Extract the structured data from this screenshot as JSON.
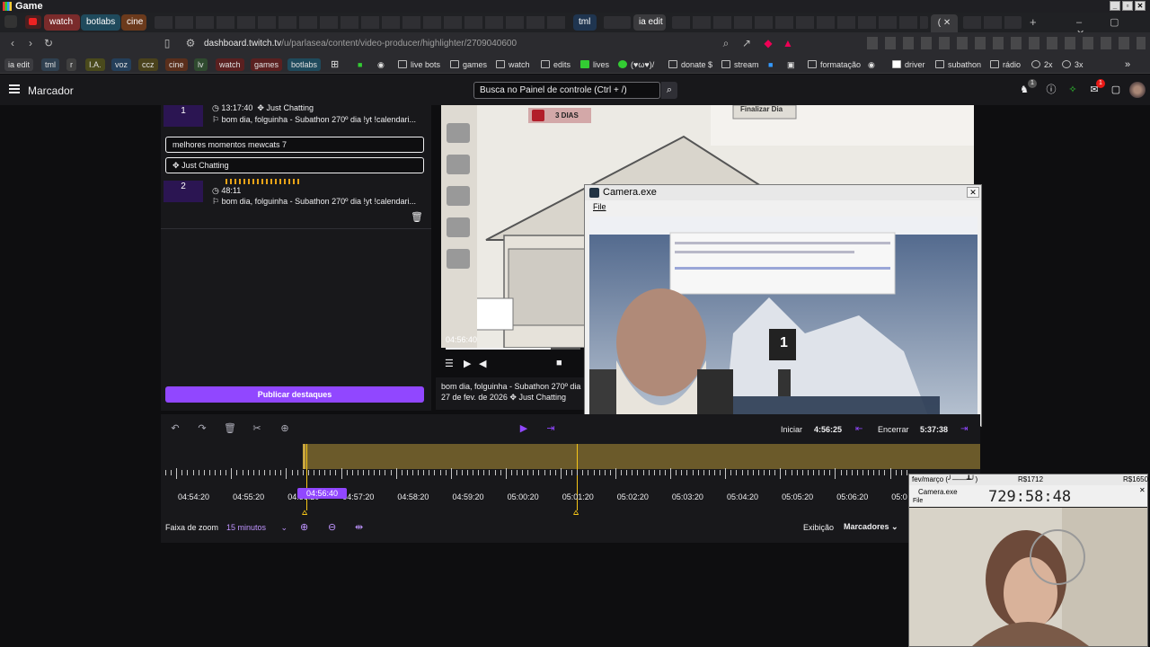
{
  "window": {
    "title": "Game"
  },
  "tabs": [
    {
      "label": "watch",
      "color": "#7a2b2b"
    },
    {
      "label": "botlabs",
      "color": "#1f4a5c"
    },
    {
      "label": "cine",
      "color": "#6b3a1c"
    },
    {
      "label": "tml",
      "color": "#1f3550"
    },
    {
      "label": "ia edit",
      "color": "#3a3a3d"
    }
  ],
  "address": {
    "host": "dashboard.twitch.tv",
    "path": "/u/parlasea/content/video-producer/highlighter/2709040600"
  },
  "bookmarks": {
    "chips": [
      {
        "label": "ia edit",
        "color": "#3c3c40"
      },
      {
        "label": "tml",
        "color": "#2f4050"
      },
      {
        "label": "r",
        "color": "#3f3f3f"
      },
      {
        "label": "I.A.",
        "color": "#4a4a1c"
      },
      {
        "label": "voz",
        "color": "#243f5a"
      },
      {
        "label": "ccz",
        "color": "#4a421c"
      },
      {
        "label": "cine",
        "color": "#5a2f1c"
      },
      {
        "label": "lv",
        "color": "#2f4a2f"
      },
      {
        "label": "watch",
        "color": "#5a2020"
      },
      {
        "label": "games",
        "color": "#5a2020"
      },
      {
        "label": "botlabs",
        "color": "#1f4a5c"
      }
    ],
    "links": [
      "live bots",
      "games",
      "watch",
      "edits",
      "lives",
      "(♥ω♥)/",
      "donate $",
      "stream",
      "formatação",
      "driver",
      "subathon",
      "rádio",
      "2x",
      "3x"
    ]
  },
  "topnav": {
    "page_title": "Marcador",
    "search_placeholder": "Busca no Painel de controle (Ctrl + /)",
    "notif_count": "1"
  },
  "clips": [
    {
      "number": "1",
      "time": "13:17:40",
      "category": "Just Chatting",
      "title": "bom dia, folguinha - Subathon 270º dia !yt !calendari..."
    },
    {
      "number": "2",
      "time": "48:11",
      "category": "",
      "title": "bom dia, folguinha - Subathon 270º dia !yt !calendari..."
    }
  ],
  "editor": {
    "title_value": "melhores momentos mewcats 7",
    "category_value": "Just Chatting",
    "publish_label": "Publicar destaques"
  },
  "game": {
    "days_badge": "3 DIAS",
    "finish_button": "Finalizar Dia"
  },
  "player": {
    "timestamp": "04:56:40"
  },
  "video_info": {
    "title": "bom dia, folguinha - Subathon 270º dia",
    "date": "27 de fev. de 2026",
    "category": "Just Chatting"
  },
  "camera_window": {
    "title": "Camera.exe",
    "menu_file": "File",
    "overlay_number": "1"
  },
  "timeline": {
    "start_label": "Iniciar",
    "start_value": "4:56:25",
    "end_label": "Encerrar",
    "end_value": "5:37:38",
    "playhead_label": "04:56:40",
    "ticks": [
      "04:54:20",
      "04:55:20",
      "04:56:20",
      "04:57:20",
      "04:58:20",
      "04:59:20",
      "05:00:20",
      "05:01:20",
      "05:02:20",
      "05:03:20",
      "05:04:20",
      "05:05:20",
      "05:06:20",
      "05:0"
    ],
    "zoom_label": "Faixa de zoom",
    "zoom_value": "15 minutos",
    "view_label": "Exibição",
    "view_value": "Marcadores"
  },
  "small_cam": {
    "header_left": "fev/março (╯——┻╯)",
    "header_mid": "R$1712",
    "header_right": "R$1650",
    "app_name": "Camera.exe",
    "menu_file": "File",
    "counter": "729:58:48"
  },
  "colors": {
    "accent": "#9147ff",
    "timeline_strip": "#6b5a2a",
    "marker": "#f5c518"
  }
}
